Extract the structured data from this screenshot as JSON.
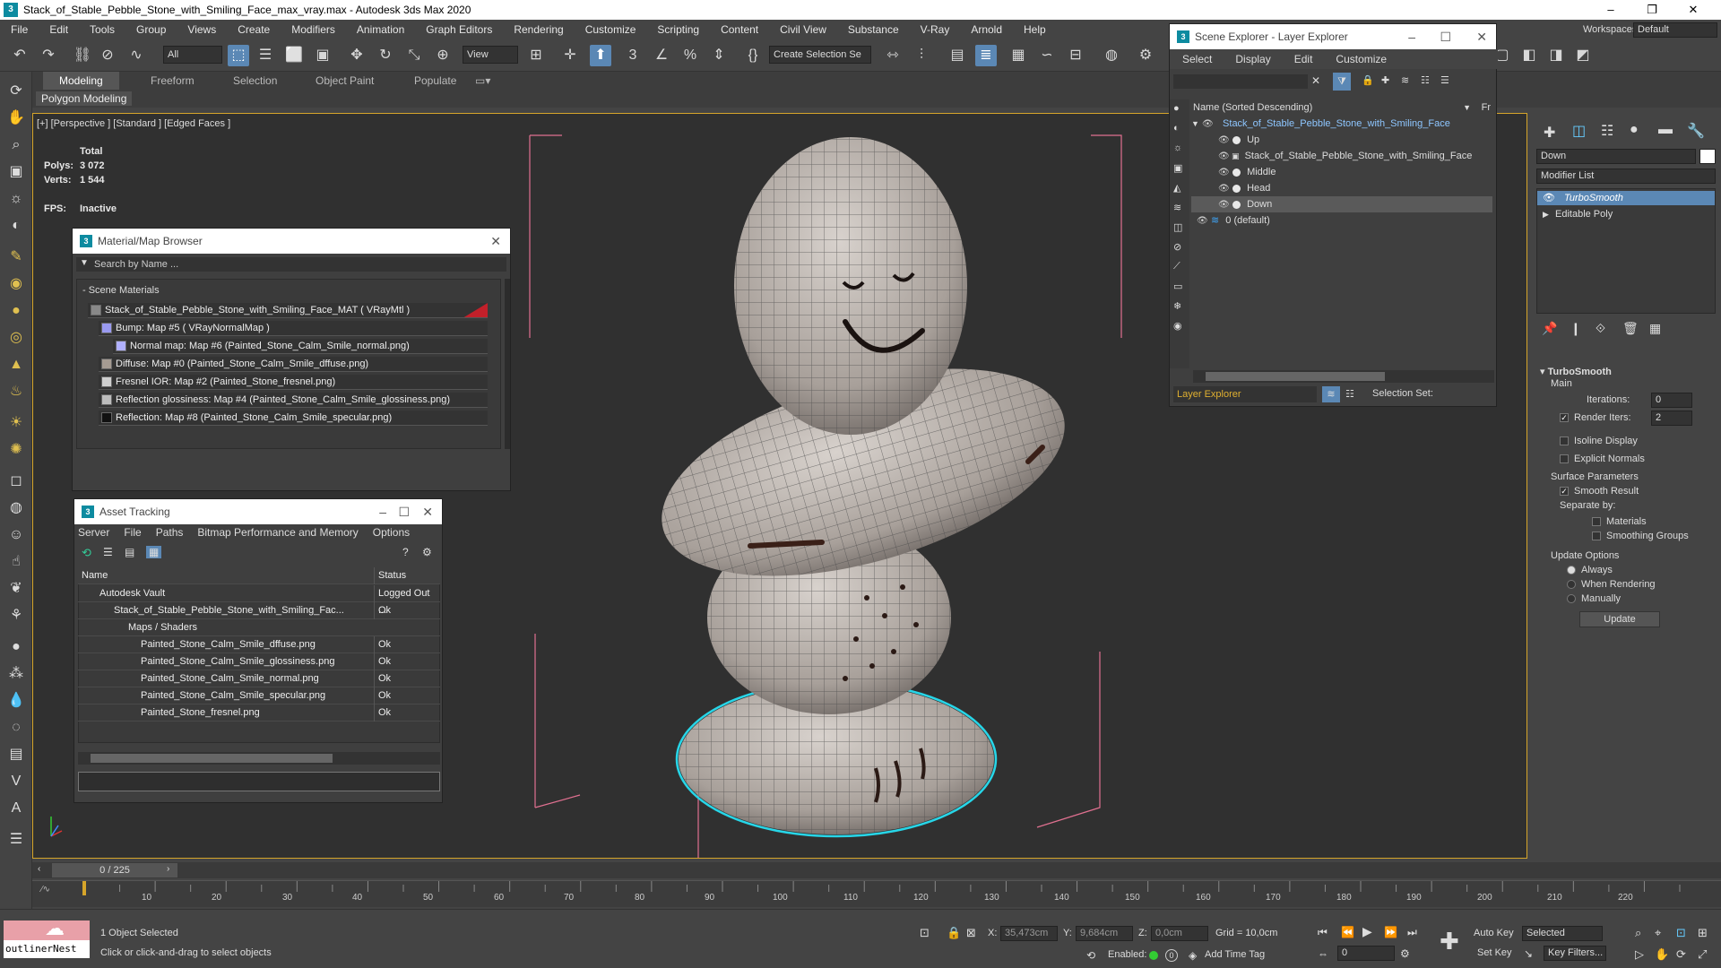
{
  "titlebar": {
    "title": "Stack_of_Stable_Pebble_Stone_with_Smiling_Face_max_vray.max - Autodesk 3ds Max 2020"
  },
  "menu": [
    "File",
    "Edit",
    "Tools",
    "Group",
    "Views",
    "Create",
    "Modifiers",
    "Animation",
    "Graph Editors",
    "Rendering",
    "Customize",
    "Scripting",
    "Content",
    "Civil View",
    "Substance",
    "V-Ray",
    "Arnold",
    "Help"
  ],
  "workspace": {
    "label": "Workspaces:",
    "value": "Default"
  },
  "toolbar": {
    "filter": "All",
    "view": "View",
    "selection_set": "Create Selection Se"
  },
  "ribbon": {
    "tabs": [
      "Modeling",
      "Freeform",
      "Selection",
      "Object Paint",
      "Populate"
    ],
    "sub": "Polygon Modeling"
  },
  "viewport": {
    "label": "[+] [Perspective ] [Standard ] [Edged Faces ]",
    "stats_total": "Total",
    "polys_label": "Polys:",
    "polys": "3 072",
    "verts_label": "Verts:",
    "verts": "1 544",
    "fps_label": "FPS:",
    "fps": "Inactive"
  },
  "material_browser": {
    "title": "Material/Map Browser",
    "search": "Search by Name ...",
    "group": "- Scene Materials",
    "rows": [
      "Stack_of_Stable_Pebble_Stone_with_Smiling_Face_MAT  ( VRayMtl )",
      "Bump: Map #5  ( VRayNormalMap )",
      "Normal map: Map #6 (Painted_Stone_Calm_Smile_normal.png)",
      "Diffuse: Map #0 (Painted_Stone_Calm_Smile_dffuse.png)",
      "Fresnel IOR: Map #2 (Painted_Stone_fresnel.png)",
      "Reflection glossiness: Map #4 (Painted_Stone_Calm_Smile_glossiness.png)",
      "Reflection: Map #8 (Painted_Stone_Calm_Smile_specular.png)"
    ]
  },
  "asset_tracking": {
    "title": "Asset Tracking",
    "menu": [
      "Server",
      "File",
      "Paths",
      "Bitmap Performance and Memory",
      "Options"
    ],
    "col_name": "Name",
    "col_status": "Status",
    "rows": [
      {
        "name": "Autodesk Vault",
        "status": "Logged Out ..."
      },
      {
        "name": "Stack_of_Stable_Pebble_Stone_with_Smiling_Fac...",
        "status": "Ok"
      },
      {
        "name": "Maps / Shaders",
        "status": ""
      },
      {
        "name": "Painted_Stone_Calm_Smile_dffuse.png",
        "status": "Ok"
      },
      {
        "name": "Painted_Stone_Calm_Smile_glossiness.png",
        "status": "Ok"
      },
      {
        "name": "Painted_Stone_Calm_Smile_normal.png",
        "status": "Ok"
      },
      {
        "name": "Painted_Stone_Calm_Smile_specular.png",
        "status": "Ok"
      },
      {
        "name": "Painted_Stone_fresnel.png",
        "status": "Ok"
      }
    ]
  },
  "scene_explorer": {
    "title": "Scene Explorer - Layer Explorer",
    "menu": [
      "Select",
      "Display",
      "Edit",
      "Customize"
    ],
    "header": "Name (Sorted Descending)",
    "header_right": "Fr",
    "rows": [
      "Stack_of_Stable_Pebble_Stone_with_Smiling_Face",
      "Up",
      "Stack_of_Stable_Pebble_Stone_with_Smiling_Face",
      "Middle",
      "Head",
      "Down",
      "0 (default)"
    ],
    "footer_left": "Layer Explorer",
    "footer_right": "Selection Set:"
  },
  "command_panel": {
    "object_name": "Down",
    "modifier_list": "Modifier List",
    "stack": [
      "TurboSmooth",
      "Editable Poly"
    ],
    "rollout": "TurboSmooth",
    "main": "Main",
    "iterations_label": "Iterations:",
    "iterations": "0",
    "render_iters_label": "Render Iters:",
    "render_iters": "2",
    "isoline": "Isoline Display",
    "explicit": "Explicit Normals",
    "surface_params": "Surface Parameters",
    "smooth_result": "Smooth Result",
    "separate_by": "Separate by:",
    "materials": "Materials",
    "smoothing_groups": "Smoothing Groups",
    "update_options": "Update Options",
    "always": "Always",
    "when_rendering": "When Rendering",
    "manually": "Manually",
    "update": "Update"
  },
  "timeline": {
    "frame": "0 / 225",
    "ticks": [
      "0",
      "10",
      "20",
      "30",
      "40",
      "50",
      "60",
      "70",
      "80",
      "90",
      "100",
      "110",
      "120",
      "130",
      "140",
      "150",
      "160",
      "170",
      "180",
      "190",
      "200",
      "210",
      "220"
    ]
  },
  "status": {
    "maxscript": "outlinerNest",
    "selected": "1 Object Selected",
    "prompt": "Click or click-and-drag to select objects",
    "x_label": "X:",
    "x": "35,473cm",
    "y_label": "Y:",
    "y": "9,684cm",
    "z_label": "Z:",
    "z": "0,0cm",
    "grid": "Grid = 10,0cm",
    "enabled": "Enabled:",
    "add_time_tag": "Add Time Tag",
    "auto_key": "Auto Key",
    "selected_dd": "Selected",
    "set_key": "Set Key",
    "key_filters": "Key Filters...",
    "frame": "0"
  },
  "colors": {
    "selection_cyan": "#27d6e8",
    "viewport_border": "#d6a52a",
    "accent_blue": "#5b88b5"
  }
}
